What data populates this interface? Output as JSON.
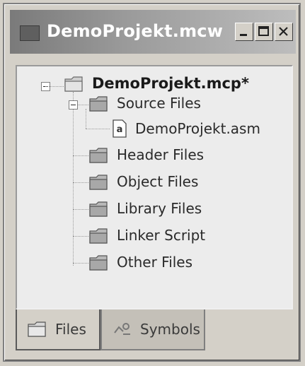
{
  "window": {
    "title": "DemoProjekt.mcw"
  },
  "tree": {
    "project": "DemoProjekt.mcp*",
    "folders": [
      {
        "label": "Source Files"
      },
      {
        "label": "Header Files"
      },
      {
        "label": "Object Files"
      },
      {
        "label": "Library Files"
      },
      {
        "label": "Linker Script"
      },
      {
        "label": "Other Files"
      }
    ],
    "source_file": "DemoProjekt.asm"
  },
  "tabs": [
    {
      "label": "Files",
      "icon": "folder-icon",
      "active": true
    },
    {
      "label": "Symbols",
      "icon": "symbols-icon",
      "active": false
    }
  ],
  "colors": {
    "folder": "#b8b8b8",
    "window_bg": "#d4d0c8"
  }
}
